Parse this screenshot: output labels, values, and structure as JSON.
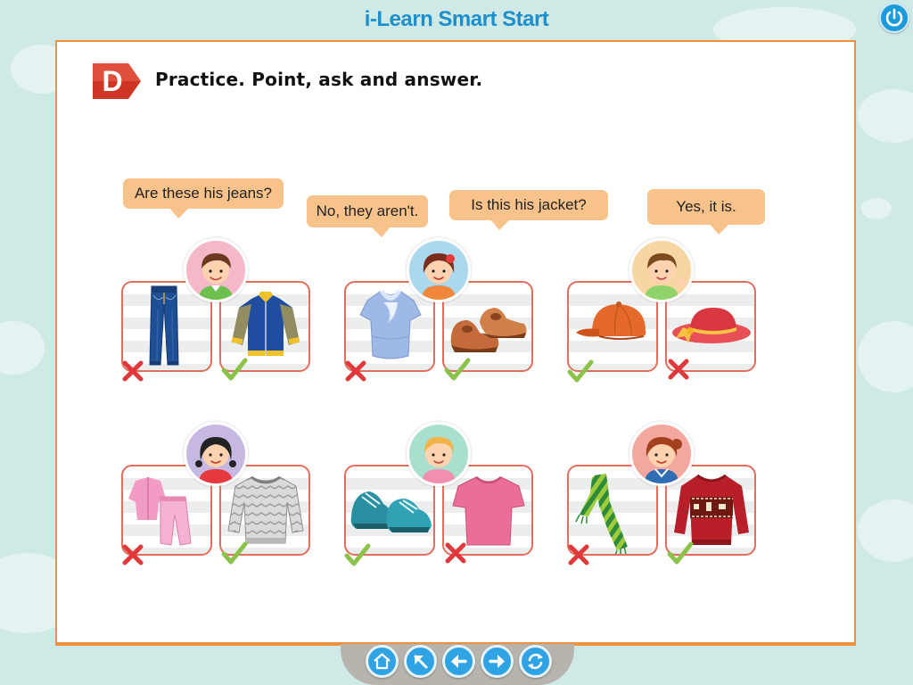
{
  "app": {
    "title": "i-Learn Smart Start"
  },
  "exercise": {
    "badge_letter": "D",
    "instruction": "Practice. Point, ask and answer."
  },
  "bubbles": [
    {
      "text": "Are these his jeans?"
    },
    {
      "text": "No, they aren't."
    },
    {
      "text": "Is this his jacket?"
    },
    {
      "text": "Yes, it is."
    }
  ],
  "groups": [
    {
      "avatar_bg": "#f4b8c8",
      "left_item": "jeans",
      "left_mark": "cross",
      "right_item": "jacket",
      "right_mark": "check"
    },
    {
      "avatar_bg": "#aad8ee",
      "left_item": "blouse",
      "left_mark": "cross",
      "right_item": "shoes",
      "right_mark": "check"
    },
    {
      "avatar_bg": "#f7d6a4",
      "left_item": "cap",
      "left_mark": "check",
      "right_item": "sun-hat",
      "right_mark": "cross"
    },
    {
      "avatar_bg": "#c7b8e3",
      "left_item": "pink-pyjamas",
      "left_mark": "cross",
      "right_item": "striped-sweater",
      "right_mark": "check"
    },
    {
      "avatar_bg": "#a9dfcf",
      "left_item": "sneakers",
      "left_mark": "check",
      "right_item": "t-shirt",
      "right_mark": "cross"
    },
    {
      "avatar_bg": "#f3a79e",
      "left_item": "scarf",
      "left_mark": "cross",
      "right_item": "red-sweater",
      "right_mark": "check"
    }
  ],
  "colors": {
    "accent": "#1e8fcd",
    "frame": "#f08f3c",
    "card_border": "#e26e5c",
    "cross": "#e0383b",
    "check": "#8bc34a",
    "bubble": "#f7c38a"
  },
  "nav": [
    {
      "icon": "home-icon"
    },
    {
      "icon": "arrow-up-left-icon"
    },
    {
      "icon": "arrow-left-icon"
    },
    {
      "icon": "arrow-right-icon"
    },
    {
      "icon": "refresh-icon"
    }
  ]
}
